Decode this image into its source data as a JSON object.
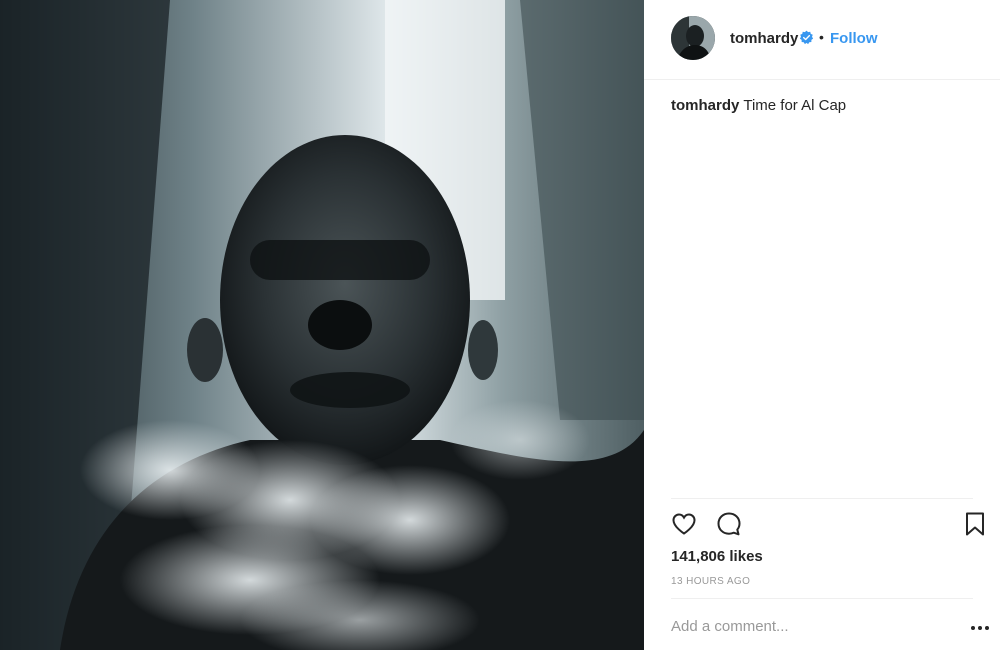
{
  "header": {
    "username": "tomhardy",
    "separator": "•",
    "follow_label": "Follow",
    "verified_icon": "verified-badge-icon",
    "accent": "#3897f0"
  },
  "caption": {
    "username": "tomhardy",
    "text": "Time for Al Cap"
  },
  "actions": {
    "like_icon": "heart-outline-icon",
    "comment_icon": "speech-bubble-icon",
    "save_icon": "bookmark-icon"
  },
  "stats": {
    "likes": "141,806 likes",
    "time": "13 HOURS AGO"
  },
  "comment": {
    "placeholder": "Add a comment...",
    "more_icon": "ellipsis-icon"
  }
}
